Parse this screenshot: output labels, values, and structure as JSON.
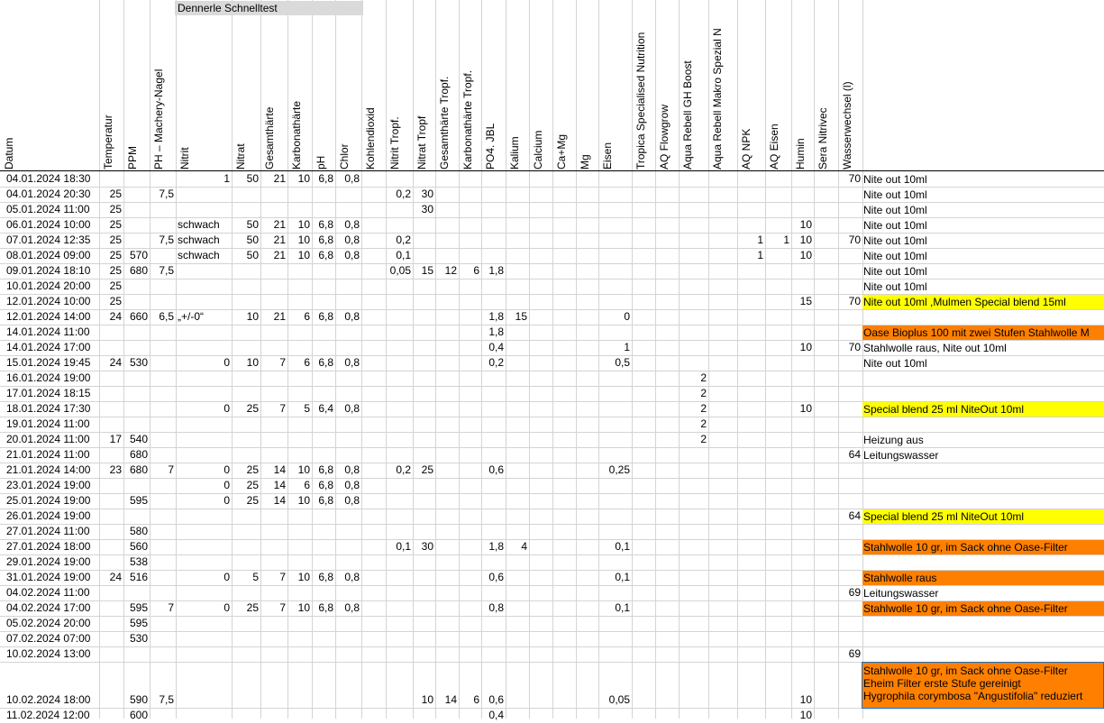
{
  "banner": "Dennerle Schnelltest",
  "headers": [
    "Datum",
    "Temperatur",
    "PPM",
    "PH – Machery-Nagel",
    "Nitrit",
    "Nitrat",
    "Gesamthärte",
    "Karbonathärte",
    "pH",
    "Chlor",
    "Kohlendioxid",
    "Nitrit Tropf.",
    "Nitrat Tropf",
    "Gesamthärte Tropf.",
    "Karbonathärte Tropf.",
    "PO4. JBL",
    "Kalium",
    "Calcium",
    "Ca+Mg",
    "Mg",
    "Eisen",
    "Tropica Specialised Nutrition",
    "AQ Flowgrow",
    "Aqua Rebell GH Boost",
    "Aqua Rebell Makro Spezial N",
    "AQ NPK",
    "AQ Eisen",
    "Humin",
    "Sera Nitrivec",
    "Wasserwechsel (l)"
  ],
  "colors": {
    "yellow": "#ffff00",
    "orange": "#ff8000",
    "grid": "#d4d4d4",
    "selection": "#1a6fc9"
  },
  "rows": [
    {
      "date": "04.01.2024 18:30",
      "v": {
        "4": "1",
        "5": "50",
        "6": "21",
        "7": "10",
        "8": "6,8",
        "9": "0,8",
        "29": "70"
      },
      "note": [
        "Nite out 10ml"
      ]
    },
    {
      "date": "04.01.2024 20:30",
      "v": {
        "1": "25",
        "3": "7,5",
        "11": "0,2",
        "12": "30"
      },
      "note": [
        "Nite out 10ml"
      ]
    },
    {
      "date": "05.01.2024 11:00",
      "v": {
        "1": "25",
        "12": "30"
      },
      "note": [
        "Nite out 10ml"
      ]
    },
    {
      "date": "06.01.2024 10:00",
      "v": {
        "1": "25",
        "4": "schwach",
        "5": "50",
        "6": "21",
        "7": "10",
        "8": "6,8",
        "9": "0,8",
        "27": "10"
      },
      "note": [
        "Nite out 10ml"
      ]
    },
    {
      "date": "07.01.2024 12:35",
      "v": {
        "1": "25",
        "3": "7,5",
        "4": "schwach",
        "5": "50",
        "6": "21",
        "7": "10",
        "8": "6,8",
        "9": "0,8",
        "11": "0,2",
        "25": "1",
        "26": "1",
        "27": "10",
        "29": "70"
      },
      "note": [
        "Nite out 10ml"
      ]
    },
    {
      "date": "08.01.2024 09:00",
      "v": {
        "1": "25",
        "2": "570",
        "4": "schwach",
        "5": "50",
        "6": "21",
        "7": "10",
        "8": "6,8",
        "9": "0,8",
        "11": "0,1",
        "25": "1",
        "27": "10"
      },
      "note": [
        "Nite out 10ml"
      ]
    },
    {
      "date": "09.01.2024 18:10",
      "v": {
        "1": "25",
        "2": "680",
        "3": "7,5",
        "11": "0,05",
        "12": "15",
        "13": "12",
        "14": "6",
        "15": "1,8"
      },
      "note": [
        "Nite out 10ml"
      ]
    },
    {
      "date": "10.01.2024 20:00",
      "v": {
        "1": "25"
      },
      "note": [
        "Nite out 10ml"
      ]
    },
    {
      "date": "12.01.2024 10:00",
      "v": {
        "1": "25",
        "27": "15",
        "29": "70"
      },
      "note": [
        "Nite out 10ml ,Mulmen Special blend 15ml"
      ],
      "color": "yellow"
    },
    {
      "date": "12.01.2024 14:00",
      "v": {
        "1": "24",
        "2": "660",
        "3": "6,5",
        "4": "„+/-0“",
        "5": "10",
        "6": "21",
        "7": "6",
        "8": "6,8",
        "9": "0,8",
        "15": "1,8",
        "16": "15",
        "20": "0"
      },
      "note": []
    },
    {
      "date": "14.01.2024 11:00",
      "v": {
        "15": "1,8"
      },
      "note": [
        "Oase Bioplus 100 mit zwei Stufen Stahlwolle M"
      ],
      "color": "orange"
    },
    {
      "date": "14.01.2024 17:00",
      "v": {
        "15": "0,4",
        "20": "1",
        "27": "10",
        "29": "70"
      },
      "note": [
        "Stahlwolle raus, Nite out 10ml"
      ]
    },
    {
      "date": "15.01.2024 19:45",
      "v": {
        "1": "24",
        "2": "530",
        "4": "0",
        "5": "10",
        "6": "7",
        "7": "6",
        "8": "6,8",
        "9": "0,8",
        "15": "0,2",
        "20": "0,5"
      },
      "note": [
        "Nite out 10ml"
      ]
    },
    {
      "date": "16.01.2024 19:00",
      "v": {
        "23": "2"
      },
      "note": []
    },
    {
      "date": "17.01.2024 18:15",
      "v": {
        "23": "2"
      },
      "note": []
    },
    {
      "date": "18.01.2024 17:30",
      "v": {
        "4": "0",
        "5": "25",
        "6": "7",
        "7": "5",
        "8": "6,4",
        "9": "0,8",
        "23": "2",
        "27": "10"
      },
      "note": [
        "Special blend 25 ml NiteOut 10ml"
      ],
      "color": "yellow"
    },
    {
      "date": "19.01.2024 11:00",
      "v": {
        "23": "2"
      },
      "note": []
    },
    {
      "date": "20.01.2024 11:00",
      "v": {
        "1": "17",
        "2": "540",
        "23": "2"
      },
      "note": [
        "Heizung aus"
      ]
    },
    {
      "date": "21.01.2024 11:00",
      "v": {
        "2": "680",
        "29": "64"
      },
      "note": [
        "Leitungswasser"
      ]
    },
    {
      "date": "21.01.2024 14:00",
      "v": {
        "1": "23",
        "2": "680",
        "3": "7",
        "4": "0",
        "5": "25",
        "6": "14",
        "7": "10",
        "8": "6,8",
        "9": "0,8",
        "11": "0,2",
        "12": "25",
        "15": "0,6",
        "20": "0,25"
      },
      "note": []
    },
    {
      "date": "23.01.2024 19:00",
      "v": {
        "4": "0",
        "5": "25",
        "6": "14",
        "7": "6",
        "8": "6,8",
        "9": "0,8"
      },
      "note": []
    },
    {
      "date": "25.01.2024 19:00",
      "v": {
        "2": "595",
        "4": "0",
        "5": "25",
        "6": "14",
        "7": "10",
        "8": "6,8",
        "9": "0,8"
      },
      "note": []
    },
    {
      "date": "26.01.2024 19:00",
      "v": {
        "29": "64"
      },
      "note": [
        "Special blend 25 ml NiteOut 10ml"
      ],
      "color": "yellow"
    },
    {
      "date": "27.01.2024 11:00",
      "v": {
        "2": "580"
      },
      "note": []
    },
    {
      "date": "27.01.2024 18:00",
      "v": {
        "2": "560",
        "11": "0,1",
        "12": "30",
        "15": "1,8",
        "16": "4",
        "20": "0,1"
      },
      "note": [
        "Stahlwolle 10 gr, im Sack ohne Oase-Filter"
      ],
      "color": "orange"
    },
    {
      "date": "29.01.2024 19:00",
      "v": {
        "2": "538"
      },
      "note": []
    },
    {
      "date": "31.01.2024 19:00",
      "v": {
        "1": "24",
        "2": "516",
        "4": "0",
        "5": "5",
        "6": "7",
        "7": "10",
        "8": "6,8",
        "9": "0,8",
        "15": "0,6",
        "20": "0,1"
      },
      "note": [
        "Stahlwolle raus"
      ],
      "color": "orange"
    },
    {
      "date": "04.02.2024 11:00",
      "v": {
        "29": "69"
      },
      "note": [
        "Leitungswasser"
      ]
    },
    {
      "date": "04.02.2024 17:00",
      "v": {
        "2": "595",
        "3": "7",
        "4": "0",
        "5": "25",
        "6": "7",
        "7": "10",
        "8": "6,8",
        "9": "0,8",
        "15": "0,8",
        "20": "0,1"
      },
      "note": [
        "Stahlwolle 10 gr, im Sack ohne Oase-Filter"
      ],
      "color": "orange"
    },
    {
      "date": "05.02.2024 20:00",
      "v": {
        "2": "595"
      },
      "note": []
    },
    {
      "date": "07.02.2024 07:00",
      "v": {
        "2": "530"
      },
      "note": []
    },
    {
      "date": "10.02.2024 13:00",
      "v": {
        "29": "69"
      },
      "note": []
    },
    {
      "date": "10.02.2024 18:00",
      "v": {
        "2": "590",
        "3": "7,5",
        "12": "10",
        "13": "14",
        "14": "6",
        "15": "0,6",
        "20": "0,05",
        "27": "10"
      },
      "note": [
        "Stahlwolle 10 gr, im Sack ohne Oase-Filter",
        "Eheim Filter erste Stufe gereinigt",
        "Hygrophila corymbosa \"Angustifolia\" reduziert"
      ],
      "color": "orange",
      "tall": true
    },
    {
      "date": "11.02.2024 12:00",
      "v": {
        "2": "600",
        "15": "0,4",
        "27": "10"
      },
      "note": []
    }
  ]
}
